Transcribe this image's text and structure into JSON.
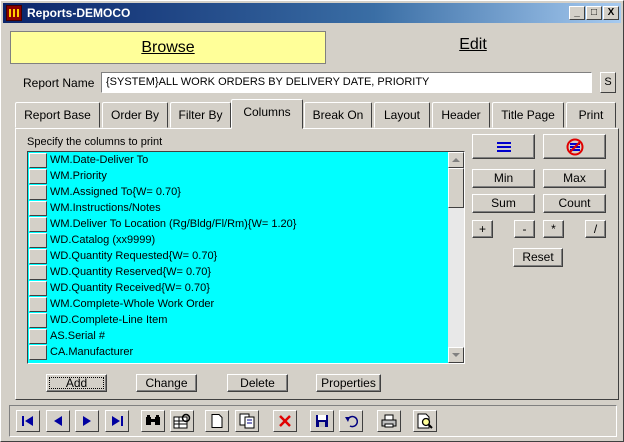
{
  "window": {
    "title": "Reports-DEMOCO",
    "controls": [
      "_",
      "□",
      "X"
    ]
  },
  "mode": {
    "browse": "Browse",
    "edit": "Edit"
  },
  "report_name": {
    "label": "Report Name",
    "value": "{SYSTEM}ALL WORK ORDERS BY DELIVERY DATE, PRIORITY",
    "side_button": "S"
  },
  "tabs": [
    {
      "label": "Report Base"
    },
    {
      "label": "Order By"
    },
    {
      "label": "Filter By"
    },
    {
      "label": "Columns",
      "active": true
    },
    {
      "label": "Break On"
    },
    {
      "label": "Layout"
    },
    {
      "label": "Header"
    },
    {
      "label": "Title Page"
    },
    {
      "label": "Print"
    }
  ],
  "columns_panel": {
    "instruction": "Specify the columns to print",
    "items": [
      "WM.Date-Deliver To",
      "WM.Priority",
      "WM.Assigned To{W= 0.70}",
      "WM.Instructions/Notes",
      "WM.Deliver To Location (Rg/Bldg/Fl/Rm){W= 1.20}",
      "WD.Catalog (xx9999)",
      "WD.Quantity Requested{W= 0.70}",
      "WD.Quantity Reserved{W= 0.70}",
      "WD.Quantity Received{W= 0.70}",
      "WM.Complete-Whole Work Order",
      "WD.Complete-Line Item",
      "AS.Serial #",
      "CA.Manufacturer"
    ],
    "list_bg": "#00ffff",
    "aggregate_buttons": [
      "Min",
      "Max",
      "Sum",
      "Count"
    ],
    "operator_buttons": [
      "+",
      "-",
      "*",
      "/"
    ],
    "reset": "Reset",
    "action_buttons": [
      "Add",
      "Change",
      "Delete",
      "Properties"
    ]
  },
  "toolbar": {
    "icons": [
      "first-record-icon",
      "previous-record-icon",
      "next-record-icon",
      "last-record-icon",
      "find-icon",
      "filter-icon",
      "new-document-icon",
      "copy-icon",
      "delete-icon",
      "save-icon",
      "undo-icon",
      "print-icon",
      "print-preview-icon"
    ]
  }
}
